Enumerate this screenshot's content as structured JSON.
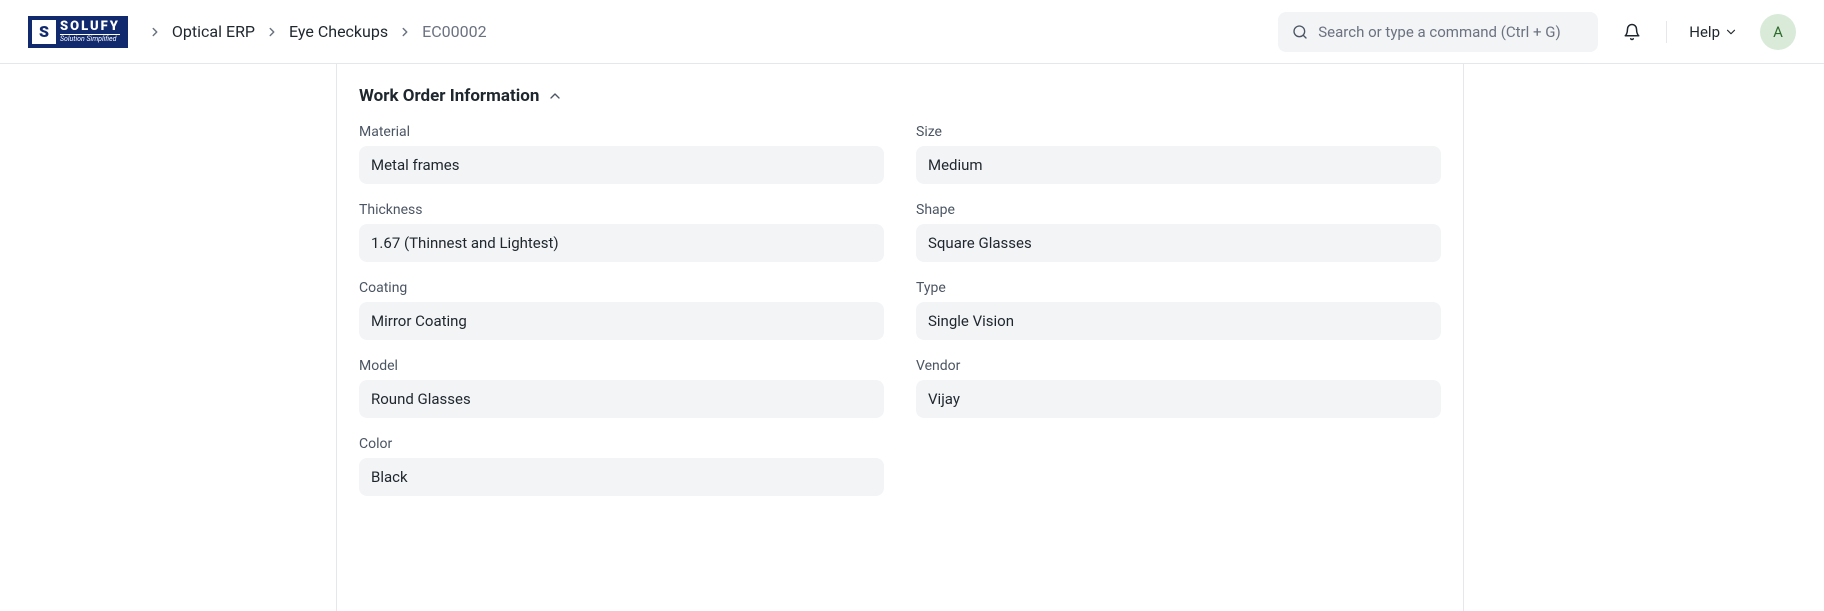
{
  "header": {
    "logo": {
      "mark": "S",
      "name": "SOLUFY",
      "tagline": "Solution Simplified"
    },
    "breadcrumb": {
      "items": [
        {
          "label": "Optical ERP",
          "link": true
        },
        {
          "label": "Eye Checkups",
          "link": true
        },
        {
          "label": "EC00002",
          "link": false
        }
      ]
    },
    "search": {
      "placeholder": "Search or type a command (Ctrl + G)"
    },
    "help_label": "Help",
    "avatar_letter": "A"
  },
  "section": {
    "title": "Work Order Information"
  },
  "fields": {
    "left": [
      {
        "label": "Material",
        "value": "Metal frames"
      },
      {
        "label": "Thickness",
        "value": "1.67 (Thinnest and Lightest)"
      },
      {
        "label": "Coating",
        "value": "Mirror Coating"
      },
      {
        "label": "Model",
        "value": "Round Glasses"
      },
      {
        "label": "Color",
        "value": "Black"
      }
    ],
    "right": [
      {
        "label": "Size",
        "value": "Medium"
      },
      {
        "label": "Shape",
        "value": "Square Glasses"
      },
      {
        "label": "Type",
        "value": "Single Vision"
      },
      {
        "label": "Vendor",
        "value": "Vijay"
      }
    ]
  }
}
